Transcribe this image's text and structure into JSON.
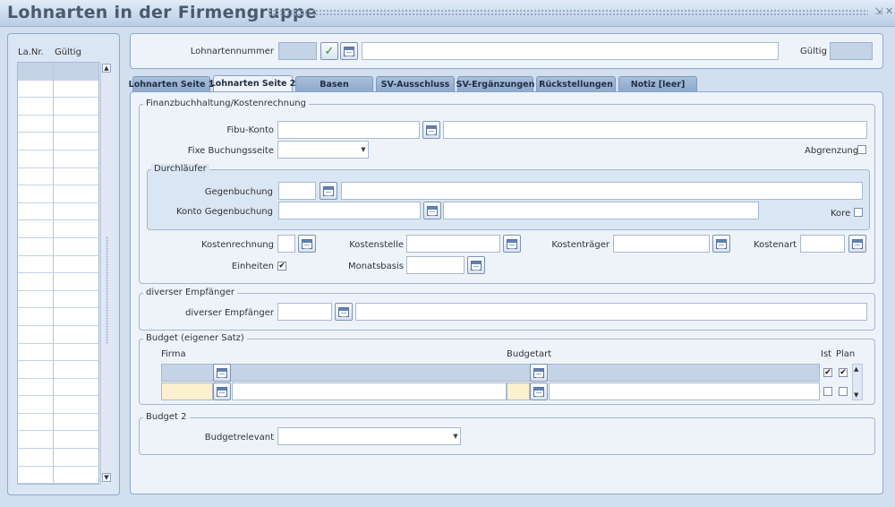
{
  "window": {
    "title": "Lohnarten in der Firmengruppe"
  },
  "list": {
    "col_nr": "La.Nr.",
    "col_gueltig": "Gültig",
    "row_count": 24
  },
  "header": {
    "lohnartennummer_label": "Lohnartennummer",
    "gueltig_label": "Gültig"
  },
  "tabs": [
    {
      "label": "Lohnarten Seite 1",
      "active": false
    },
    {
      "label": "Lohnarten Seite 2",
      "active": true
    },
    {
      "label": "Basen",
      "active": false
    },
    {
      "label": "SV-Ausschluss",
      "active": false
    },
    {
      "label": "SV-Ergänzungen",
      "active": false
    },
    {
      "label": "Rückstellungen",
      "active": false
    },
    {
      "label": "Notiz [leer]",
      "active": false
    }
  ],
  "fibu": {
    "legend": "Finanzbuchhaltung/Kostenrechnung",
    "fibu_konto": "Fibu-Konto",
    "fixe_buchungsseite": "Fixe Buchungsseite",
    "abgrenzung": "Abgrenzung",
    "durchlaeufer": {
      "legend": "Durchläufer",
      "gegenbuchung": "Gegenbuchung",
      "konto_gegenbuchung": "Konto Gegenbuchung",
      "kore": "Kore"
    },
    "kostenrechnung": "Kostenrechnung",
    "kostenstelle": "Kostenstelle",
    "kostentraeger": "Kostenträger",
    "kostenart": "Kostenart",
    "einheiten": "Einheiten",
    "einheiten_checked": true,
    "monatsbasis": "Monatsbasis"
  },
  "empfaenger": {
    "legend": "diverser Empfänger",
    "label": "diverser Empfänger"
  },
  "budget": {
    "legend": "Budget (eigener Satz)",
    "col_firma": "Firma",
    "col_budgetart": "Budgetart",
    "col_ist": "Ist",
    "col_plan": "Plan"
  },
  "budget2": {
    "legend": "Budget 2",
    "budgetrelevant": "Budgetrelevant"
  }
}
